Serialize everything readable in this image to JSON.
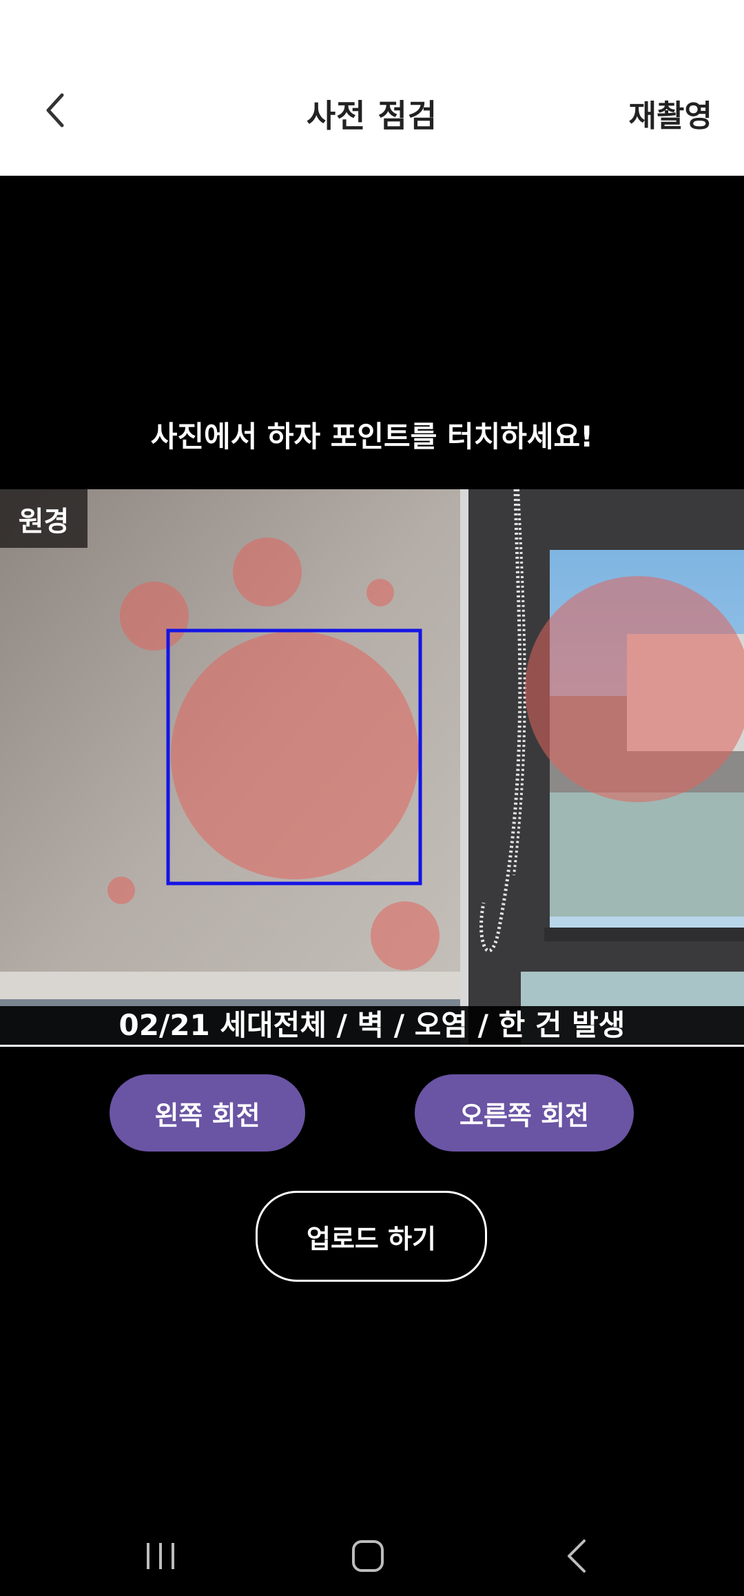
{
  "header": {
    "title": "사전 점검",
    "retake_label": "재촬영"
  },
  "instruction": "사진에서 하자 포인트를 터치하세요!",
  "photo": {
    "badge": "원경",
    "caption": "02/21 세대전체 / 벽 / 오염 / 한 건 발생"
  },
  "buttons": {
    "rotate_left": "왼쪽 회전",
    "rotate_right": "오른쪽 회전",
    "upload": "업로드 하기"
  },
  "colors": {
    "accent": "#6a54a4",
    "marker": "#e0645c",
    "selection": "#1414e6"
  },
  "icons": {
    "back": "chevron-left-icon",
    "nav_recent": "recent-apps-icon",
    "nav_home": "home-icon",
    "nav_back": "nav-back-icon"
  }
}
